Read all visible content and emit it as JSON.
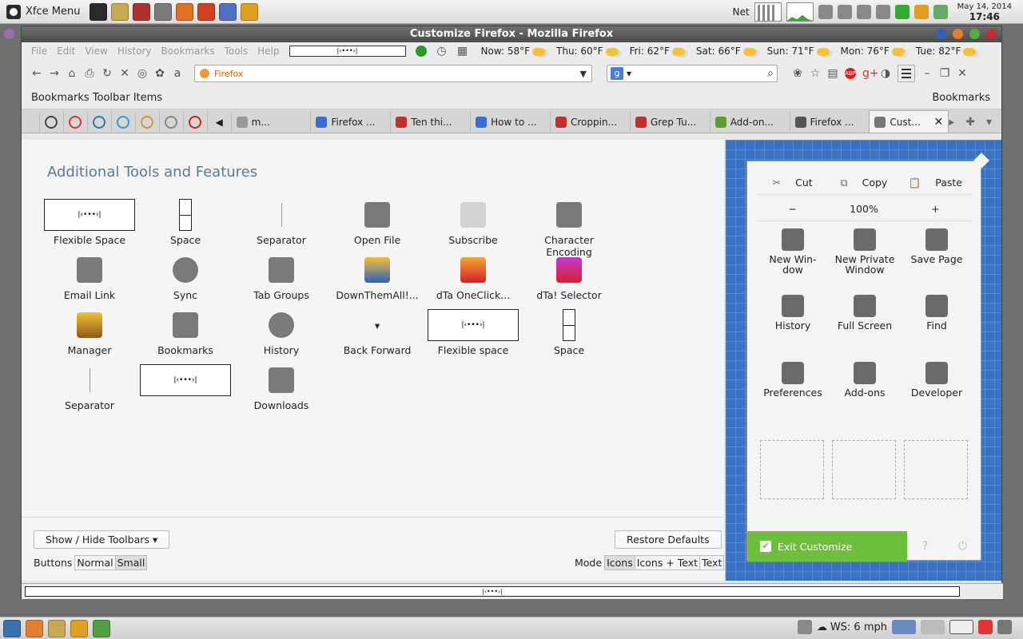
{
  "top_panel": {
    "menu_label": "Xfce Menu",
    "launcher_colors": [
      "#2b2b2b",
      "#c8a850",
      "#b03030",
      "#7a7a7a",
      "#e07020",
      "#d04020",
      "#5070c0",
      "#e0a020"
    ],
    "net_label": "Net",
    "date": "May 14, 2014",
    "time": "17:46"
  },
  "window": {
    "title": "Customize Firefox - Mozilla Firefox",
    "title_button_colors": [
      "#3060c0",
      "#e08030",
      "#50b040",
      "#c03030"
    ]
  },
  "menubar": {
    "items": [
      "File",
      "Edit",
      "View",
      "History",
      "Bookmarks",
      "Tools",
      "Help"
    ],
    "weather": [
      "Now: 58°F",
      "Thu: 60°F",
      "Fri: 62°F",
      "Sat: 66°F",
      "Sun: 71°F",
      "Mon: 76°F",
      "Tue: 82°F"
    ]
  },
  "navbar": {
    "url_label": "Firefox",
    "search_engine": "g"
  },
  "bookmarks": {
    "left": "Bookmarks Toolbar Items",
    "right": "Bookmarks"
  },
  "tabs": {
    "pinned_colors": [
      "#444",
      "#d33",
      "#37a",
      "#39c",
      "#c93",
      "#888",
      "#c22"
    ],
    "items": [
      {
        "label": "m...",
        "color": "#999"
      },
      {
        "label": "Firefox ...",
        "color": "#3a6fd0"
      },
      {
        "label": "Ten thi...",
        "color": "#c0302a"
      },
      {
        "label": "How to ...",
        "color": "#3a6fd0"
      },
      {
        "label": "Croppin...",
        "color": "#c0302a"
      },
      {
        "label": "Grep Tu...",
        "color": "#c0302a"
      },
      {
        "label": "Add-on...",
        "color": "#5aa030"
      },
      {
        "label": "Firefox ...",
        "color": "#555"
      },
      {
        "label": "Cust...",
        "color": "#777"
      }
    ]
  },
  "palette": {
    "heading": "Additional Tools and Features",
    "items": [
      {
        "label": "Flexible Space",
        "kind": "flex"
      },
      {
        "label": "Space",
        "kind": "space"
      },
      {
        "label": "Separator",
        "kind": "sep"
      },
      {
        "label": "Open File",
        "kind": "folder"
      },
      {
        "label": "Subscribe",
        "kind": "rss"
      },
      {
        "label": "Character Encoding",
        "kind": "charenc"
      },
      {
        "label": "Email Link",
        "kind": "mail"
      },
      {
        "label": "Sync",
        "kind": "sync"
      },
      {
        "label": "Tab Groups",
        "kind": "tabgroups"
      },
      {
        "label": "DownThemAll!...",
        "kind": "dta-blue"
      },
      {
        "label": "dTa OneClick...",
        "kind": "dta-orange"
      },
      {
        "label": "dTa! Selector",
        "kind": "dta-purple"
      },
      {
        "label": "Manager",
        "kind": "manager"
      },
      {
        "label": "Bookmarks",
        "kind": "star"
      },
      {
        "label": "History",
        "kind": "clock"
      },
      {
        "label": "Back Forward",
        "kind": "backfwd"
      },
      {
        "label": "Flexible space",
        "kind": "flex"
      },
      {
        "label": "Space",
        "kind": "space"
      },
      {
        "label": "Separator",
        "kind": "sep"
      },
      {
        "label": "",
        "kind": "flex"
      },
      {
        "label": "Downloads",
        "kind": "download"
      }
    ],
    "show_hide_toolbars": "Show / Hide Toolbars",
    "restore_defaults": "Restore Defaults",
    "buttons_label": "Buttons",
    "buttons_options": [
      "Normal",
      "Small"
    ],
    "buttons_selected": "Small",
    "mode_label": "Mode",
    "mode_options": [
      "Icons",
      "Icons + Text",
      "Text"
    ],
    "mode_selected": "Icons"
  },
  "menu_panel": {
    "edit": [
      "Cut",
      "Copy",
      "Paste"
    ],
    "zoom": [
      "−",
      "100%",
      "+"
    ],
    "grid": [
      {
        "label": "New Win-\ndow",
        "icon": "window-icon"
      },
      {
        "label": "New Private\nWindow",
        "icon": "mask-icon"
      },
      {
        "label": "Save Page",
        "icon": "page-icon"
      },
      {
        "label": "History",
        "icon": "clock-icon"
      },
      {
        "label": "Full Screen",
        "icon": "fullscreen-icon"
      },
      {
        "label": "Find",
        "icon": "magnifier-icon"
      },
      {
        "label": "Preferences",
        "icon": "gear-icon"
      },
      {
        "label": "Add-ons",
        "icon": "puzzle-icon"
      },
      {
        "label": "Developer",
        "icon": "wrench-icon"
      }
    ],
    "exit_label": "Exit Customize",
    "exit_color": "#6bbf3a"
  },
  "bottom_panel": {
    "ws_label": "WS: 6 mph",
    "task_colors": [
      "#3a6fb0",
      "#e08030",
      "#c8a850",
      "#e0a020",
      "#50a040"
    ]
  }
}
